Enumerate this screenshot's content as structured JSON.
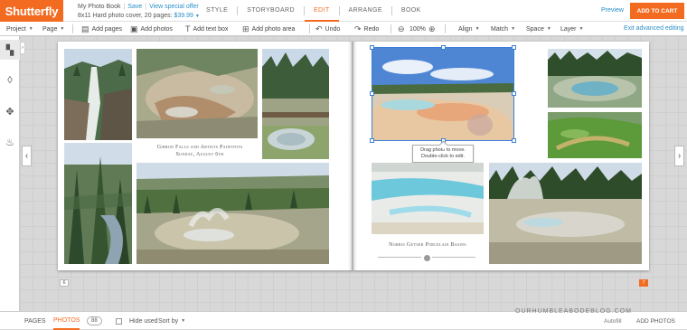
{
  "app": {
    "logo": "Shutterfly"
  },
  "project": {
    "name": "My Photo Book",
    "save": "Save",
    "offer": "View special offer",
    "description": "8x11 Hard photo cover, 20 pages:",
    "price": "$39.99"
  },
  "tabs": [
    "STYLE",
    "STORYBOARD",
    "EDIT",
    "ARRANGE",
    "BOOK"
  ],
  "active_tab": "EDIT",
  "header": {
    "preview": "Preview",
    "cart": "ADD TO CART"
  },
  "toolbar": {
    "project": "Project",
    "page": "Page",
    "add_pages": "Add pages",
    "add_photos": "Add photos",
    "add_text_box": "Add text box",
    "add_photo_area": "Add photo area",
    "undo": "Undo",
    "redo": "Redo",
    "zoom": "100%",
    "align": "Align",
    "match": "Match",
    "space": "Space",
    "layer": "Layer",
    "exit_advanced": "Exit advanced editing"
  },
  "captions": {
    "left_1": "Gibbon Falls and Artists Paintpots",
    "left_2": "Sunday, August 6th",
    "right": "Norris Geyser Porcelain Basins"
  },
  "tooltip": {
    "line1": "Drag photo to move.",
    "line2": "Double-click to edit."
  },
  "page_numbers": {
    "left": "6",
    "right": "7"
  },
  "bottombar": {
    "pages": "PAGES",
    "photos": "PHOTOS",
    "photo_count": "88",
    "hide_used": "Hide used",
    "sort_by": "Sort by",
    "autofill": "Autofill",
    "add_photos": "ADD PHOTOS"
  },
  "watermark": "OURHUMBLEABODEBLOG.COM",
  "icons": {
    "undo": "undo-icon",
    "redo": "redo-icon",
    "zoom_out": "zoom-out-icon",
    "zoom_in": "zoom-in-icon",
    "layouts": "layouts-icon",
    "backgrounds": "backgrounds-icon",
    "embellishments": "embellishments-icon",
    "ideas": "ideas-icon"
  },
  "colors": {
    "brand": "#f26b21",
    "link": "#2a8fc6",
    "selection": "#3b7fd6"
  }
}
